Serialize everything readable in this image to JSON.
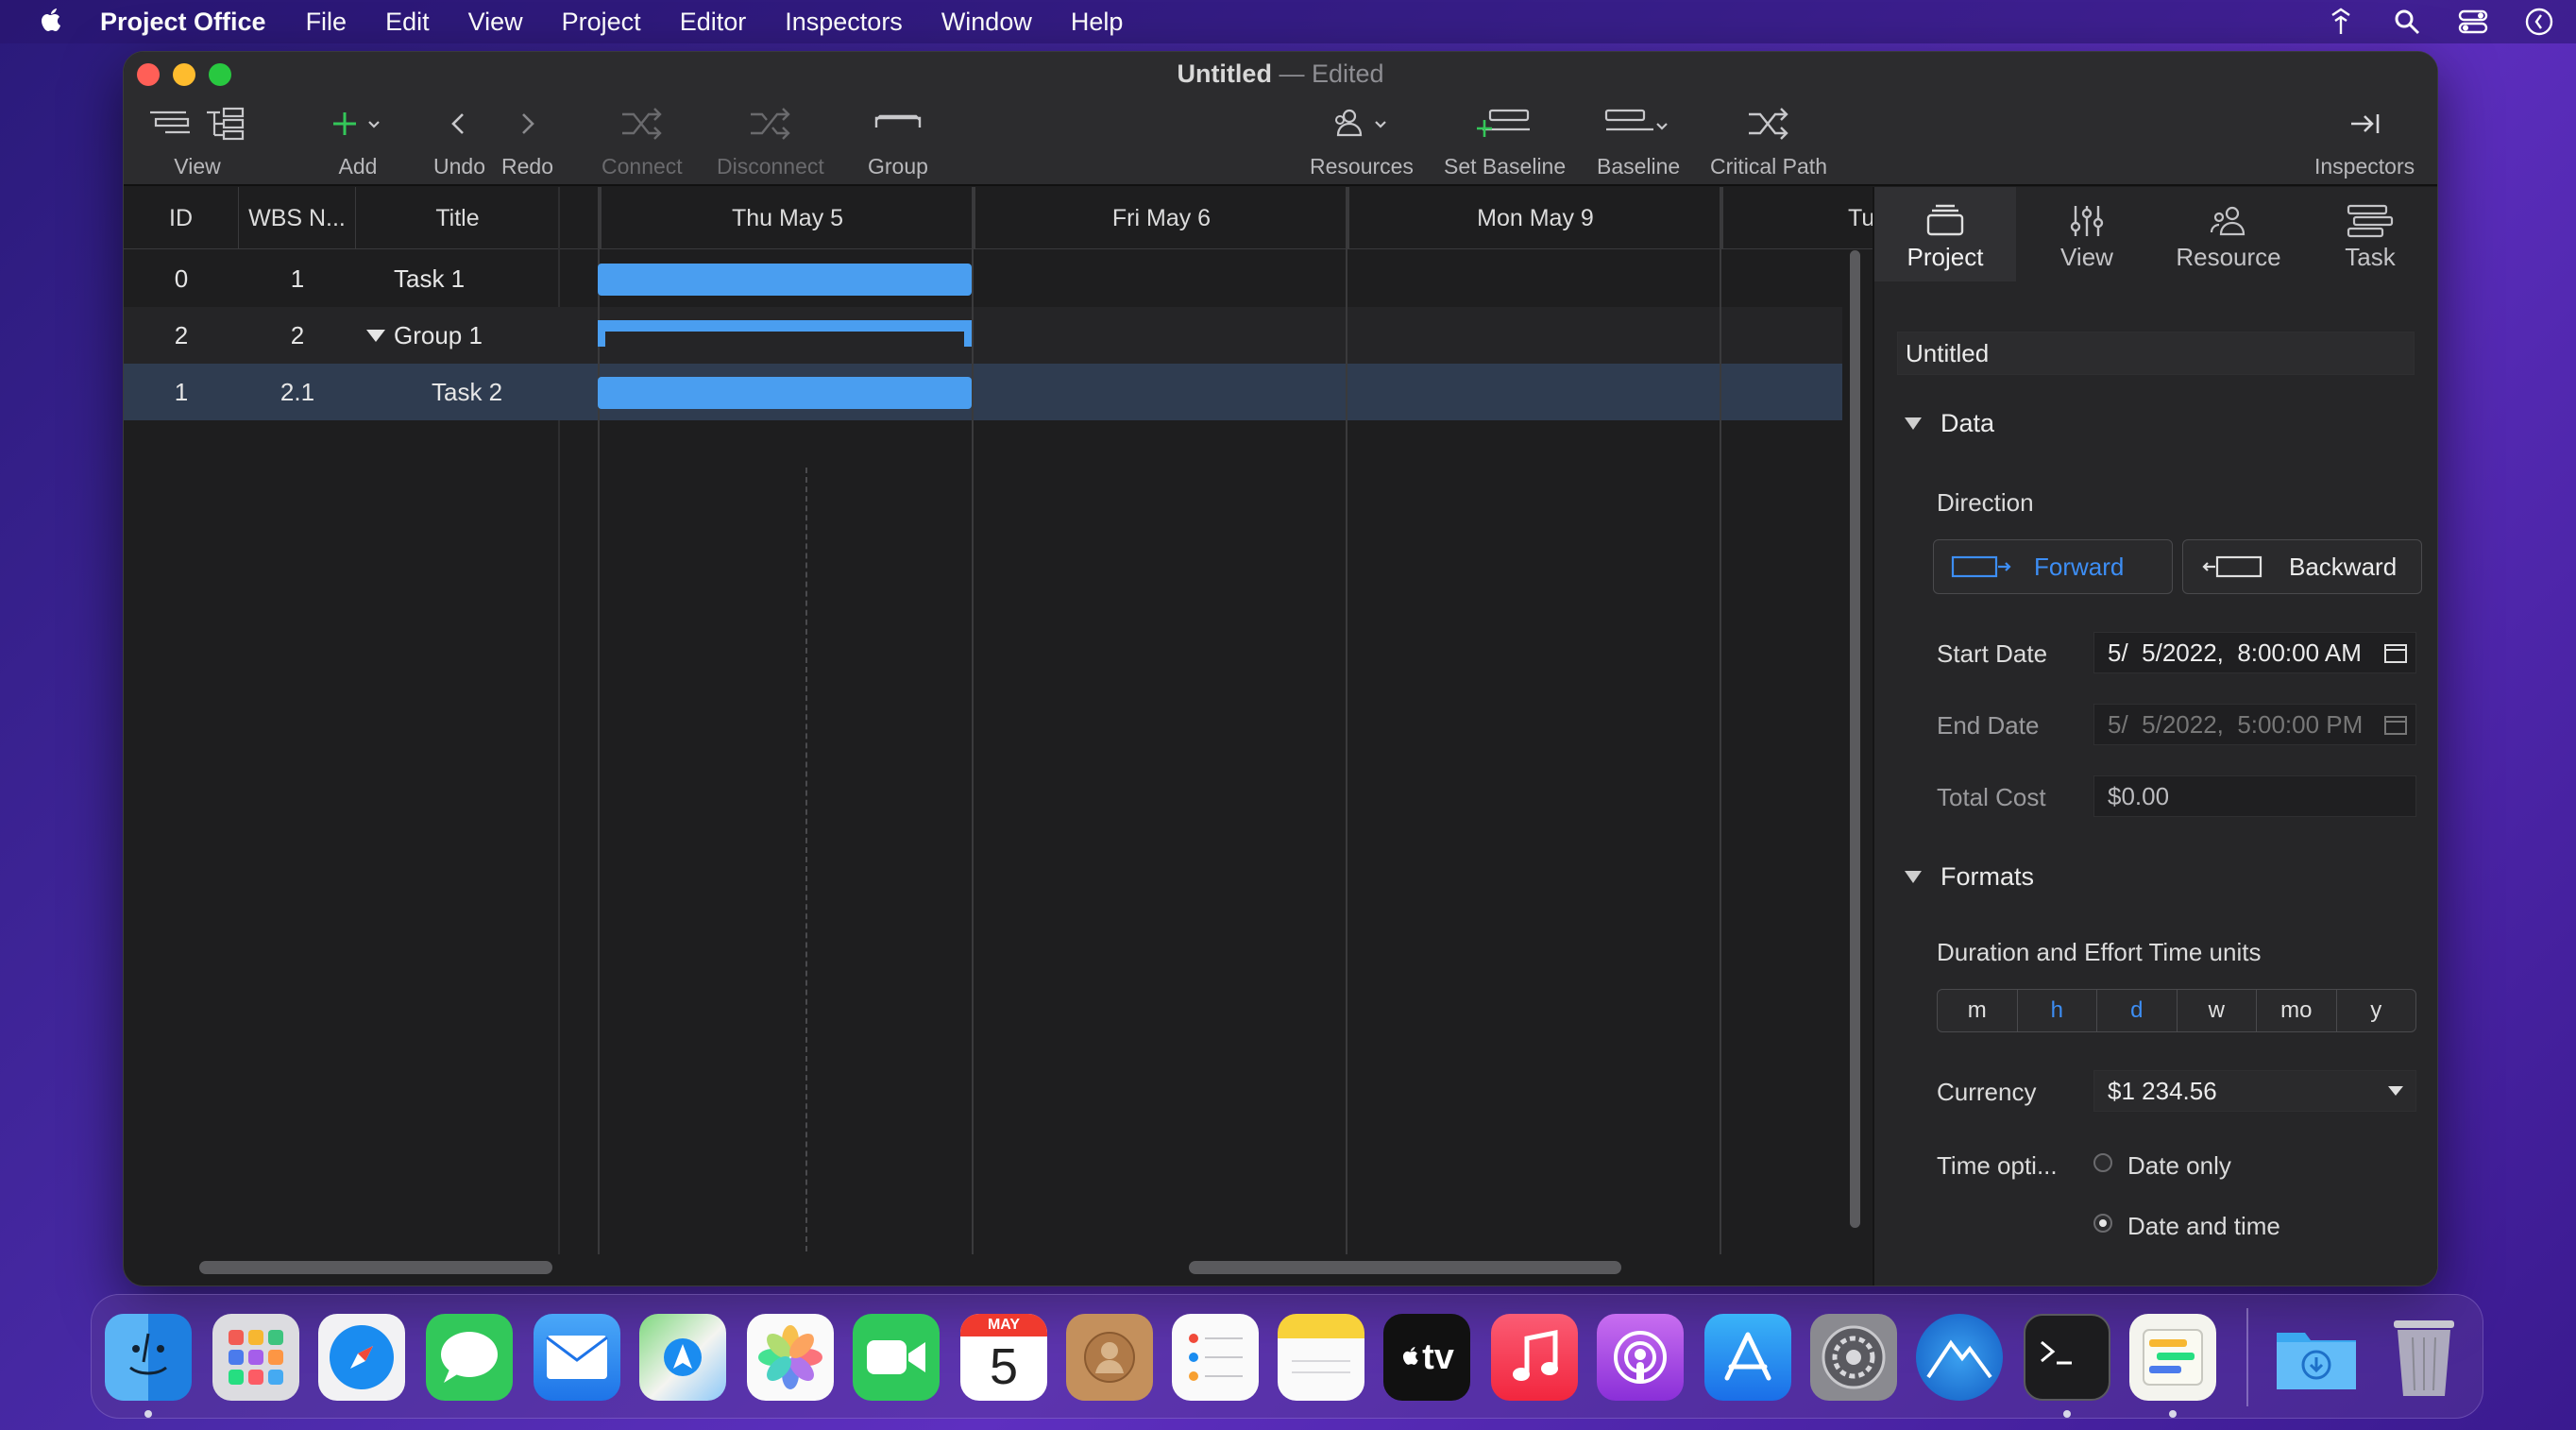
{
  "menubar": {
    "app_name": "Project Office",
    "items": [
      "File",
      "Edit",
      "View",
      "Project",
      "Editor",
      "Inspectors",
      "Window",
      "Help"
    ]
  },
  "window": {
    "title": "Untitled",
    "separator": "—",
    "status": "Edited"
  },
  "toolbar": {
    "view": "View",
    "add": "Add",
    "undo": "Undo",
    "redo": "Redo",
    "connect": "Connect",
    "disconnect": "Disconnect",
    "group": "Group",
    "resources": "Resources",
    "set_baseline": "Set Baseline",
    "baseline": "Baseline",
    "critical_path": "Critical Path",
    "inspectors": "Inspectors"
  },
  "table": {
    "headers": [
      "ID",
      "WBS N...",
      "Title"
    ],
    "rows": [
      {
        "id": "0",
        "wbs": "1",
        "title": "Task 1"
      },
      {
        "id": "2",
        "wbs": "2",
        "title": "Group 1"
      },
      {
        "id": "1",
        "wbs": "2.1",
        "title": "Task 2"
      }
    ]
  },
  "gantt": {
    "days": [
      "Thu May 5",
      "Fri May 6",
      "Mon May 9",
      "Tu"
    ]
  },
  "inspector": {
    "tabs": [
      "Project",
      "View",
      "Resource",
      "Task"
    ],
    "project_name": "Untitled",
    "data_section": "Data",
    "direction_label": "Direction",
    "forward": "Forward",
    "backward": "Backward",
    "start_date_label": "Start Date",
    "start_date_value": "5/  5/2022,  8:00:00 AM",
    "end_date_label": "End Date",
    "end_date_value": "5/  5/2022,  5:00:00 PM",
    "total_cost_label": "Total Cost",
    "total_cost_value": "$0.00",
    "formats_section": "Formats",
    "time_units_label": "Duration and Effort Time units",
    "time_units": [
      "m",
      "h",
      "d",
      "w",
      "mo",
      "y"
    ],
    "currency_label": "Currency",
    "currency_value": "$1 234.56",
    "time_options_label": "Time opti...",
    "option_date_only": "Date only",
    "option_date_time": "Date and time"
  },
  "dock": {
    "calendar_month": "MAY",
    "calendar_day": "5",
    "tv_label": "tv"
  },
  "colors": {
    "accent": "#3d8ef5",
    "bar": "#4a9ef0",
    "selected_row": "#2f3c50"
  }
}
